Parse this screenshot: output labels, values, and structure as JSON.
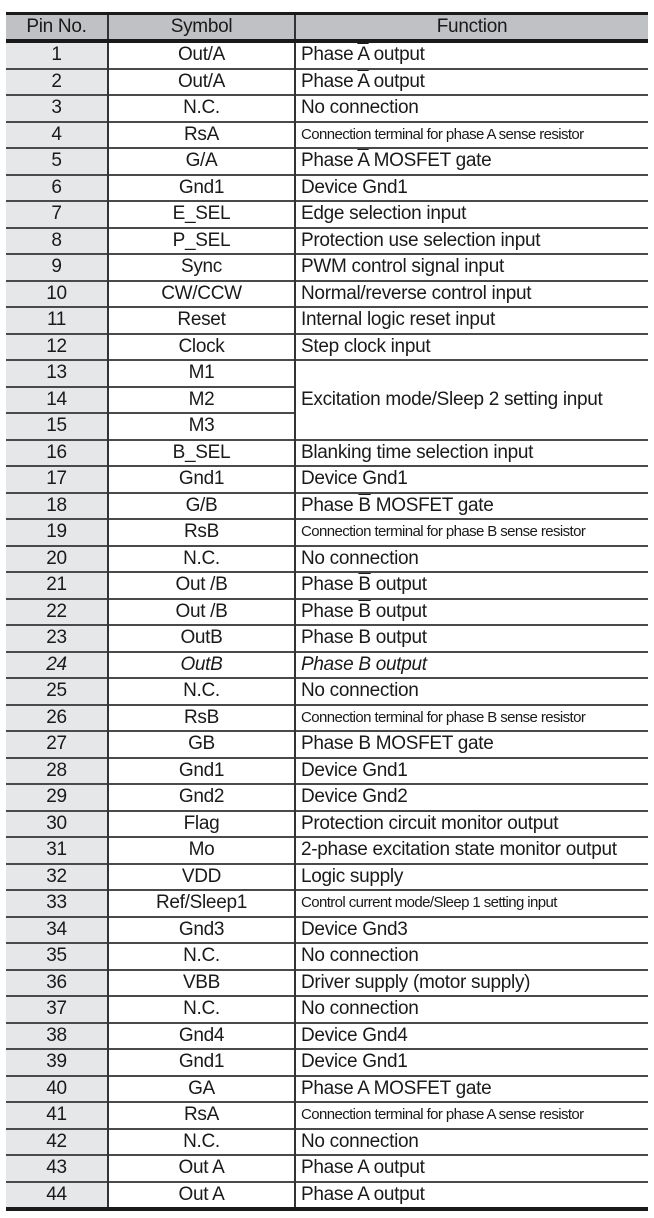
{
  "table": {
    "headers": [
      "Pin No.",
      "Symbol",
      "Function"
    ],
    "rows": [
      {
        "pin": "1",
        "symbol": "Out/A",
        "function_pre": "Phase ",
        "function_bar": "A",
        "function_post": " output"
      },
      {
        "pin": "2",
        "symbol": "Out/A",
        "function_pre": "Phase ",
        "function_bar": "A",
        "function_post": " output"
      },
      {
        "pin": "3",
        "symbol": "N.C.",
        "function": "No connection"
      },
      {
        "pin": "4",
        "symbol": "RsA",
        "function": "Connection terminal for phase A sense resistor",
        "small": true
      },
      {
        "pin": "5",
        "symbol": "G/A",
        "function_pre": "Phase ",
        "function_bar": "A",
        "function_post": " MOSFET gate"
      },
      {
        "pin": "6",
        "symbol": "Gnd1",
        "function": "Device Gnd1"
      },
      {
        "pin": "7",
        "symbol": "E_SEL",
        "function": "Edge selection input"
      },
      {
        "pin": "8",
        "symbol": "P_SEL",
        "function": "Protection use selection input"
      },
      {
        "pin": "9",
        "symbol": "Sync",
        "function": "PWM control signal input"
      },
      {
        "pin": "10",
        "symbol": "CW/CCW",
        "function": "Normal/reverse control input"
      },
      {
        "pin": "11",
        "symbol": "Reset",
        "function": "Internal logic reset input"
      },
      {
        "pin": "12",
        "symbol": "Clock",
        "function": "Step clock input"
      },
      {
        "pin": "13",
        "symbol": "M1",
        "function": "Excitation mode/Sleep 2 setting input",
        "rowspan": 3
      },
      {
        "pin": "14",
        "symbol": "M2"
      },
      {
        "pin": "15",
        "symbol": "M3"
      },
      {
        "pin": "16",
        "symbol": "B_SEL",
        "function": "Blanking time selection input"
      },
      {
        "pin": "17",
        "symbol": "Gnd1",
        "function": "Device Gnd1"
      },
      {
        "pin": "18",
        "symbol": "G/B",
        "function_pre": "Phase ",
        "function_bar": "B",
        "function_post": " MOSFET gate"
      },
      {
        "pin": "19",
        "symbol": "RsB",
        "function": "Connection terminal for phase B sense resistor",
        "small": true
      },
      {
        "pin": "20",
        "symbol": "N.C.",
        "function": "No connection"
      },
      {
        "pin": "21",
        "symbol": "Out /B",
        "function_pre": "Phase ",
        "function_bar": "B",
        "function_post": " output"
      },
      {
        "pin": "22",
        "symbol": "Out /B",
        "function_pre": "Phase ",
        "function_bar": "B",
        "function_post": " output"
      },
      {
        "pin": "23",
        "symbol": "OutB",
        "function": "Phase B output"
      },
      {
        "pin": "24",
        "symbol": "OutB",
        "function": "Phase B output",
        "italic": true
      },
      {
        "pin": "25",
        "symbol": "N.C.",
        "function": "No connection"
      },
      {
        "pin": "26",
        "symbol": "RsB",
        "function": "Connection terminal for phase B sense resistor",
        "small": true
      },
      {
        "pin": "27",
        "symbol": "GB",
        "function": "Phase B MOSFET gate"
      },
      {
        "pin": "28",
        "symbol": "Gnd1",
        "function": "Device Gnd1"
      },
      {
        "pin": "29",
        "symbol": "Gnd2",
        "function": "Device Gnd2"
      },
      {
        "pin": "30",
        "symbol": "Flag",
        "function": "Protection circuit monitor output"
      },
      {
        "pin": "31",
        "symbol": "Mo",
        "function": "2-phase excitation state monitor output"
      },
      {
        "pin": "32",
        "symbol": "VDD",
        "function": "Logic supply"
      },
      {
        "pin": "33",
        "symbol": "Ref/Sleep1",
        "function": "Control current mode/Sleep 1 setting input",
        "small": true
      },
      {
        "pin": "34",
        "symbol": "Gnd3",
        "function": "Device Gnd3"
      },
      {
        "pin": "35",
        "symbol": "N.C.",
        "function": "No connection"
      },
      {
        "pin": "36",
        "symbol": "VBB",
        "function": "Driver supply (motor supply)"
      },
      {
        "pin": "37",
        "symbol": "N.C.",
        "function": "No connection"
      },
      {
        "pin": "38",
        "symbol": "Gnd4",
        "function": "Device Gnd4"
      },
      {
        "pin": "39",
        "symbol": "Gnd1",
        "function": "Device Gnd1"
      },
      {
        "pin": "40",
        "symbol": "GA",
        "function": "Phase A MOSFET gate"
      },
      {
        "pin": "41",
        "symbol": "RsA",
        "function": "Connection terminal for phase A sense resistor",
        "small": true
      },
      {
        "pin": "42",
        "symbol": "N.C.",
        "function": "No connection"
      },
      {
        "pin": "43",
        "symbol": "Out A",
        "function": "Phase A output"
      },
      {
        "pin": "44",
        "symbol": "Out A",
        "function": "Phase A output"
      }
    ]
  }
}
